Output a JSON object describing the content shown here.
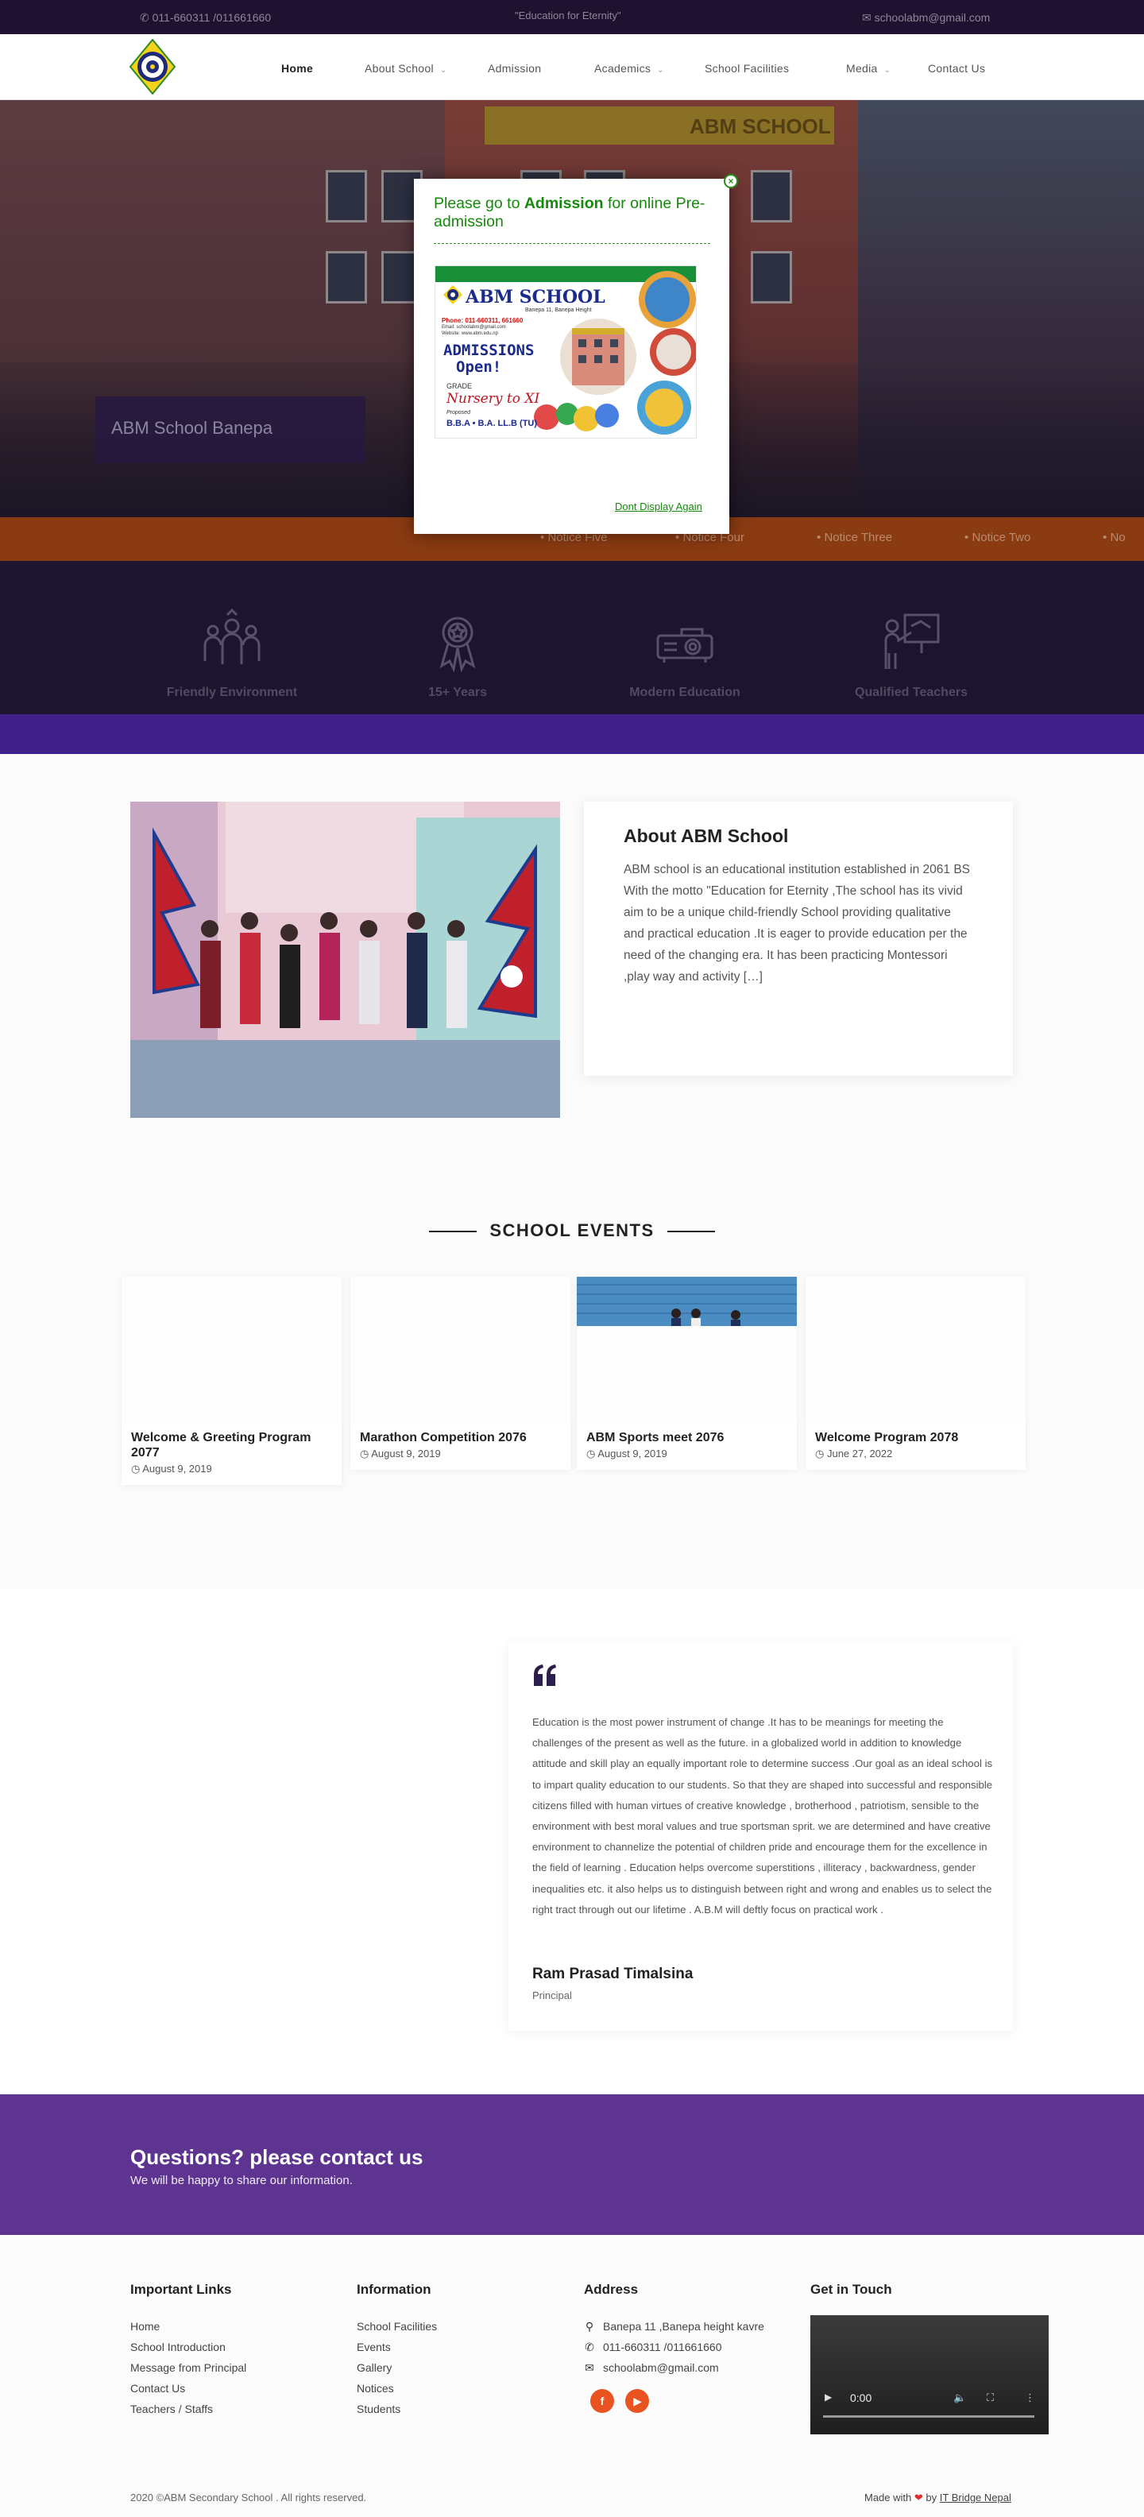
{
  "topbar": {
    "phone": "011-660311 /011661660",
    "motto": "\"Education for Eternity\"",
    "email": "schoolabm@gmail.com"
  },
  "nav": {
    "items": [
      {
        "label": "Home",
        "has_dropdown": false,
        "active": true
      },
      {
        "label": "About School",
        "has_dropdown": true
      },
      {
        "label": "Admission",
        "has_dropdown": false
      },
      {
        "label": "Academics",
        "has_dropdown": true
      },
      {
        "label": "School Facilities",
        "has_dropdown": false
      },
      {
        "label": "Media",
        "has_dropdown": true
      },
      {
        "label": "Contact Us",
        "has_dropdown": false
      }
    ]
  },
  "hero": {
    "caption": "ABM School Banepa",
    "sign_text": "ABM SCHOOL"
  },
  "ticker": {
    "items": [
      "Notice Five",
      "Notice Four",
      "Notice Three",
      "Notice Two",
      "No"
    ]
  },
  "features": [
    {
      "label": "Friendly Environment",
      "icon": "people-icon"
    },
    {
      "label": "15+ Years",
      "icon": "award-medal-icon"
    },
    {
      "label": "Modern Education",
      "icon": "projector-icon"
    },
    {
      "label": "Qualified Teachers",
      "icon": "teacher-board-icon"
    }
  ],
  "about": {
    "title": "About ABM School",
    "text": "ABM school is an educational institution established in 2061 BS With the motto \"Education for Eternity ,The school has its vivid aim to be a unique child-friendly School providing qualitative and practical education .It is eager to provide education per the need of the changing era. It has been practicing Montessori ,play way and activity […]"
  },
  "events": {
    "title": "SCHOOL EVENTS",
    "items": [
      {
        "title": "Welcome & Greeting Program 2077",
        "date": "August 9, 2019"
      },
      {
        "title": "Marathon Competition 2076",
        "date": "August 9, 2019"
      },
      {
        "title": "ABM Sports meet 2076",
        "date": "August 9, 2019"
      },
      {
        "title": "Welcome Program 2078",
        "date": "June 27, 2022"
      }
    ]
  },
  "principal": {
    "message": "Education is the most power instrument of change .It has to be meanings for meeting the challenges of the present as well as the future. in a globalized world in addition to knowledge attitude and skill play an equally important role to determine success .Our goal as an ideal school is to impart quality education to our students. So that they are shaped into successful and responsible citizens filled with human virtues of creative knowledge , brotherhood , patriotism, sensible to the environment with best moral values and true sportsman sprit. we are determined and have creative environment to channelize the potential of children pride and encourage them for the excellence in the field of learning . Education helps overcome superstitions , illiteracy , backwardness, gender inequalities etc. it also helps us to distinguish between right and wrong and enables us to select the right tract through out our lifetime . A.B.M will deftly focus on practical work .",
    "name": "Ram Prasad Timalsina",
    "role": "Principal"
  },
  "cta": {
    "heading": "Questions? please contact us",
    "sub": "We will be happy to share our information."
  },
  "footer": {
    "important_links": {
      "heading": "Important Links",
      "links": [
        "Home",
        "School Introduction",
        "Message from Principal",
        "Contact Us",
        "Teachers / Staffs"
      ]
    },
    "information": {
      "heading": "Information",
      "links": [
        "School Facilities",
        "Events",
        "Gallery",
        "Notices",
        "Students"
      ]
    },
    "address": {
      "heading": "Address",
      "location": "Banepa 11 ,Banepa height kavre",
      "phone": "011-660311 /011661660",
      "email": "schoolabm@gmail.com",
      "social": [
        "facebook-icon",
        "youtube-icon"
      ]
    },
    "get_in_touch": {
      "heading": "Get in Touch",
      "video_time": "0:00"
    },
    "copyright": "2020 ©ABM Secondary School . All rights reserved.",
    "made_with_prefix": "Made with",
    "made_with_by": "by",
    "made_with_link": "IT Bridge Nepal"
  },
  "modal": {
    "heading_prefix": "Please go to",
    "heading_bold": "Admission",
    "heading_suffix": "for online Pre-admission",
    "dont_display": "Dont Display Again",
    "flyer": {
      "title": "ABM SCHOOL",
      "sub": "Banepa 11, Banepa Height",
      "phone": "Phone: 011-660311, 661660",
      "email": "Email: schoolabm@gmail.com",
      "web": "Website: www.abm.edu.np",
      "admissions_line1": "ADMISSIONS",
      "admissions_line2": "Open!",
      "grade": "GRADE",
      "nursery": "Nursery to XI",
      "proposed": "Proposed",
      "bba": "B.B.A • B.A. LL.B (TU)"
    }
  },
  "colors": {
    "topbar_bg": "#1f1230",
    "feature_bg": "#1d1430",
    "purple_strip": "#3e2088",
    "cta_bg": "#5e3491",
    "ticker_bg": "#8a3b12",
    "modal_green": "#158a0a",
    "social_orange": "#e8531f"
  }
}
